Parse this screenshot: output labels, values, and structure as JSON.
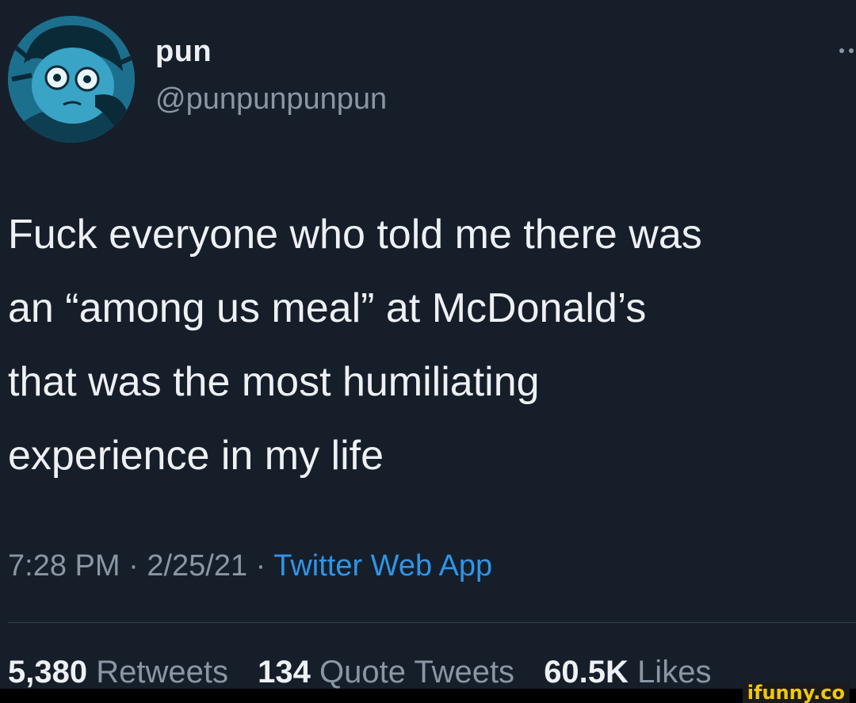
{
  "author": {
    "display_name": "pun",
    "handle": "@punpunpunpun",
    "avatar_icon": "cartoon-avatar"
  },
  "tweet": {
    "text": "Fuck everyone who told me there was\nan “among us meal” at McDonald’s\nthat was the most humiliating\nexperience in my life",
    "time": "7:28 PM",
    "separator": "·",
    "date": "2/25/21",
    "source": "Twitter Web App"
  },
  "stats": {
    "retweets_count": "5,380",
    "retweets_label": "Retweets",
    "quotes_count": "134",
    "quotes_label": "Quote Tweets",
    "likes_count": "60.5K",
    "likes_label": "Likes"
  },
  "watermark": "ifunny.co",
  "colors": {
    "background": "#161e2a",
    "text": "#eef1f4",
    "muted": "#8a96a3",
    "link": "#2f95e6",
    "watermark": "#f2c80a"
  }
}
